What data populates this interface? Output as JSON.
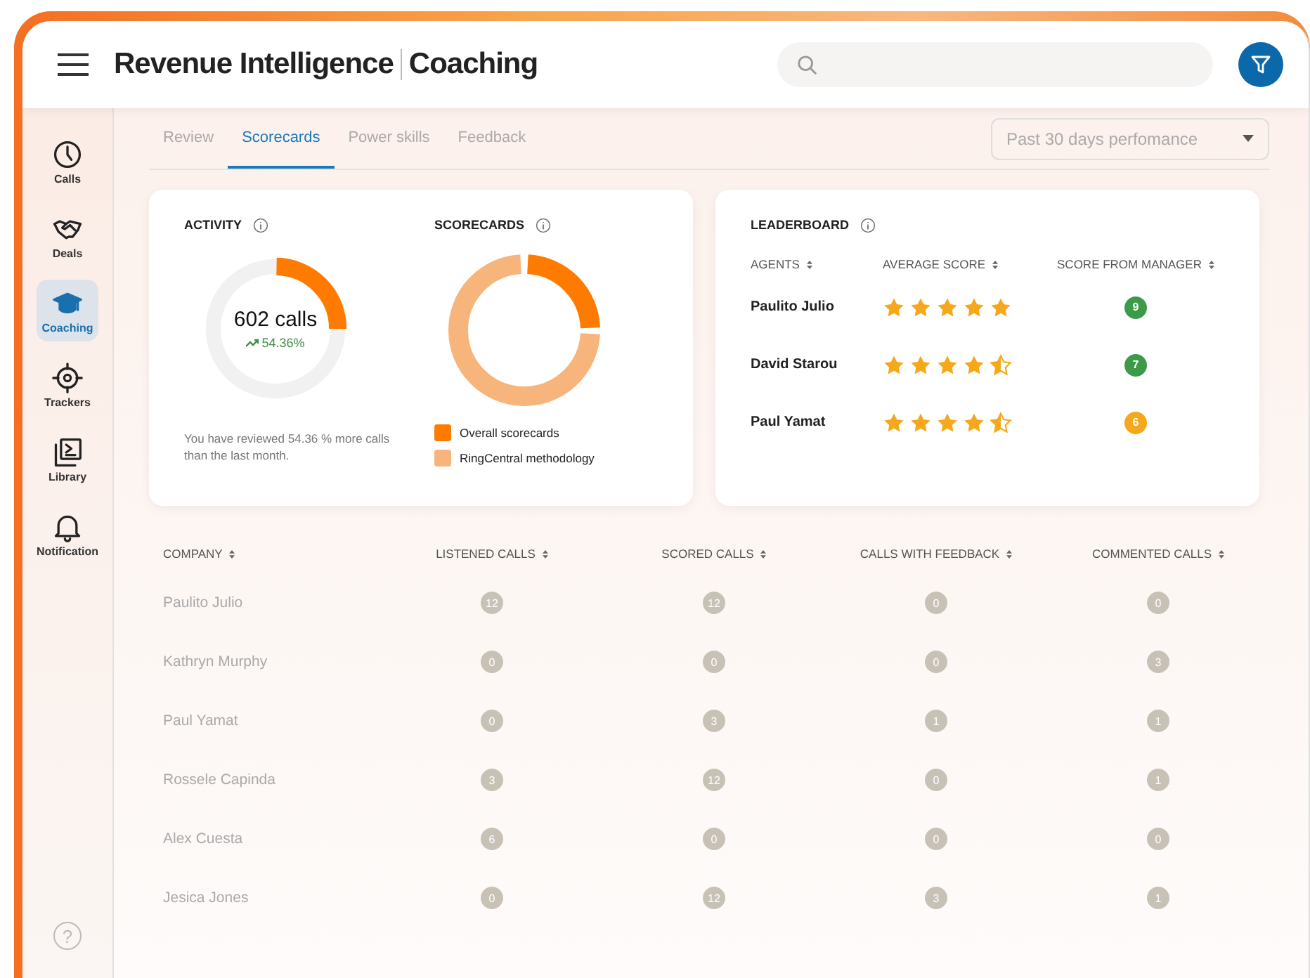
{
  "header": {
    "title": "Revenue Intelligence",
    "section": "Coaching"
  },
  "sidebar": {
    "items": [
      {
        "label": "Calls",
        "kind": "clock",
        "selected": false
      },
      {
        "label": "Deals",
        "kind": "handshake",
        "selected": false
      },
      {
        "label": "Coaching",
        "kind": "cap",
        "selected": true
      },
      {
        "label": "Trackers",
        "kind": "target",
        "selected": false
      },
      {
        "label": "Library",
        "kind": "library",
        "selected": false
      },
      {
        "label": "Notification",
        "kind": "bell",
        "selected": false
      }
    ],
    "help": "?"
  },
  "tabs": [
    {
      "label": "Review",
      "selected": false
    },
    {
      "label": "Scorecards",
      "selected": true
    },
    {
      "label": "Power skills",
      "selected": false
    },
    {
      "label": "Feedback",
      "selected": false
    }
  ],
  "period_select": {
    "value": "Past 30 days perfomance"
  },
  "activity": {
    "title": "ACTIVITY",
    "total": "602 calls",
    "change": "54.36%",
    "note": "You have reviewed 54.36 % more calls than the last month."
  },
  "scorecards": {
    "title": "SCORECARDS",
    "legend": [
      {
        "label": "Overall scorecards",
        "color": "#ff7b00"
      },
      {
        "label": "RingCentral methodology",
        "color": "#f7b57c"
      }
    ]
  },
  "leaderboard": {
    "title": "LEADERBOARD",
    "columns": [
      "AGENTS",
      "AVERAGE SCORE",
      "SCORE FROM MANAGER"
    ],
    "rows": [
      {
        "agent": "Paulito Julio",
        "stars": 5,
        "manager_score": "9",
        "color": "#3d9a48"
      },
      {
        "agent": "David Starou",
        "stars": 4.5,
        "manager_score": "7",
        "color": "#3d9a48"
      },
      {
        "agent": "Paul Yamat",
        "stars": 4.5,
        "manager_score": "6",
        "color": "#f5a81c"
      }
    ]
  },
  "table": {
    "columns": [
      "COMPANY",
      "LISTENED CALLS",
      "SCORED CALLS",
      "CALLS WITH FEEDBACK",
      "COMMENTED CALLS"
    ],
    "rows": [
      {
        "company": "Paulito Julio",
        "counts": [
          "12",
          "12",
          "0",
          "0"
        ]
      },
      {
        "company": "Kathryn Murphy",
        "counts": [
          "0",
          "0",
          "0",
          "3"
        ]
      },
      {
        "company": "Paul Yamat",
        "counts": [
          "0",
          "3",
          "1",
          "1"
        ]
      },
      {
        "company": "Rossele Capinda",
        "counts": [
          "3",
          "12",
          "0",
          "1"
        ]
      },
      {
        "company": "Alex Cuesta",
        "counts": [
          "6",
          "0",
          "0",
          "0"
        ]
      },
      {
        "company": "Jesica Jones",
        "counts": [
          "0",
          "12",
          "3",
          "1"
        ]
      }
    ]
  }
}
